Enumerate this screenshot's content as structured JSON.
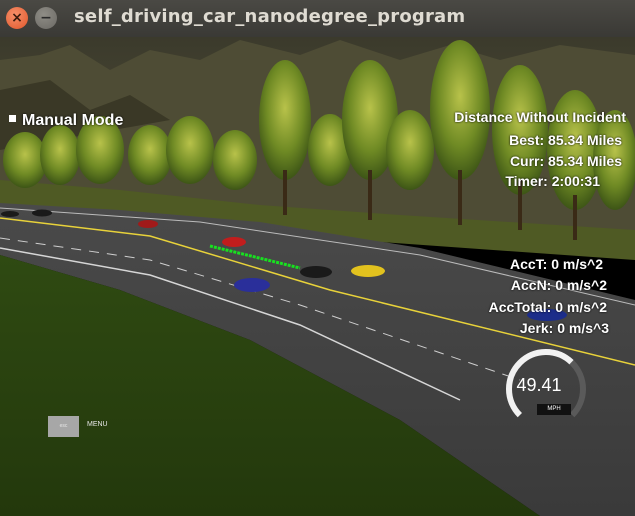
{
  "window": {
    "title": "self_driving_car_nanodegree_program",
    "close_glyph": "×",
    "minimize_glyph": "−"
  },
  "hud": {
    "mode": "Manual Mode",
    "distance_title": "Distance Without Incident",
    "best": "Best: 85.34 Miles",
    "curr": "Curr: 85.34 Miles",
    "timer": "Timer: 2:00:31",
    "acc_t": "AccT: 0 m/s^2",
    "acc_n": "AccN: 0 m/s^2",
    "acc_total": "AccTotal: 0 m/s^2",
    "jerk": "Jerk: 0 m/s^3"
  },
  "speedometer": {
    "speed": "49.41",
    "unit": "MPH",
    "fill_fraction": 0.66
  },
  "controls": {
    "esc_label": "esc",
    "menu_label": "MENU"
  },
  "colors": {
    "ego_car": "#2a2f9a",
    "path": "#18e020",
    "lane_line": "#e8d23a"
  }
}
